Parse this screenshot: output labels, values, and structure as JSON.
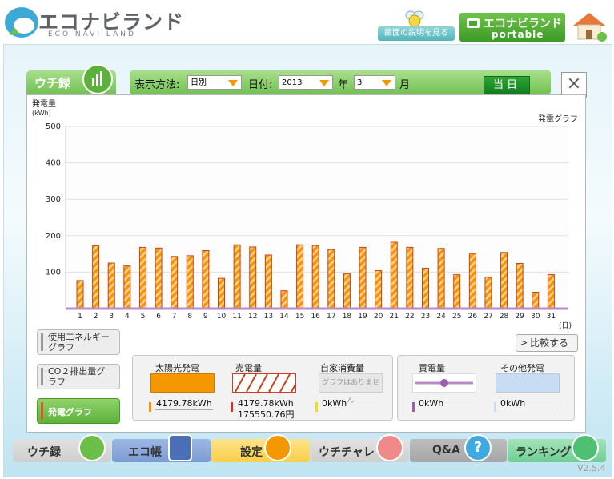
{
  "header": {
    "logo_text": "エコナビランド",
    "logo_sub": "ECO NAVI LAND",
    "help_label": "画面の説明を見る",
    "portable_label": "エコナビランド",
    "portable_sub": "portable"
  },
  "tab": {
    "label": "ウチ録"
  },
  "controls": {
    "display_method_label": "表示方法:",
    "display_method_value": "日別",
    "date_label": "日付:",
    "year_value": "2013",
    "year_unit": "年",
    "month_value": "3",
    "month_unit": "月",
    "today_label": "当日",
    "close_label": "×"
  },
  "side_buttons": [
    {
      "label": "使用エネルギーグラフ",
      "active": false
    },
    {
      "label": "CO２排出量グラフ",
      "active": false
    },
    {
      "label": "発電グラフ",
      "active": true
    }
  ],
  "compare_label": "比較する",
  "legend": {
    "solar": {
      "title": "太陽光発電",
      "value": "4179.78kWh"
    },
    "sold": {
      "title": "売電量",
      "value": "4179.78kWh",
      "value2": "175550.76円"
    },
    "self": {
      "title": "自家消費量",
      "placeholder": "グラフはありません",
      "value": "0kWh"
    },
    "bought": {
      "title": "買電量",
      "value": "0kWh"
    },
    "other": {
      "title": "その他発電",
      "value": "0kWh"
    }
  },
  "nav": [
    {
      "label": "ウチ録"
    },
    {
      "label": "エコ帳"
    },
    {
      "label": "設定"
    },
    {
      "label": "ウチチャレ"
    },
    {
      "label": "Q&A"
    },
    {
      "label": "ランキング"
    }
  ],
  "version": "V2.5.4",
  "colors": {
    "bar_fill": "#f39800",
    "bar_stripe": "#e06010",
    "baseline": "#b88bc8"
  },
  "chart_data": {
    "type": "bar",
    "title": "発電グラフ",
    "ylabel": "発電量",
    "yunit": "(kWh)",
    "xunit": "(日)",
    "ylim": [
      0,
      500
    ],
    "yticks": [
      100,
      200,
      300,
      400,
      500
    ],
    "grid": true,
    "categories": [
      "1",
      "2",
      "3",
      "4",
      "5",
      "6",
      "7",
      "8",
      "9",
      "10",
      "11",
      "12",
      "13",
      "14",
      "15",
      "16",
      "17",
      "18",
      "19",
      "20",
      "21",
      "22",
      "23",
      "24",
      "25",
      "26",
      "27",
      "28",
      "29",
      "30",
      "31"
    ],
    "values": [
      77,
      172,
      125,
      117,
      168,
      166,
      143,
      145,
      159,
      83,
      175,
      169,
      147,
      49,
      175,
      173,
      162,
      96,
      168,
      104,
      182,
      168,
      111,
      165,
      93,
      151,
      86,
      154,
      124,
      45,
      93
    ]
  }
}
